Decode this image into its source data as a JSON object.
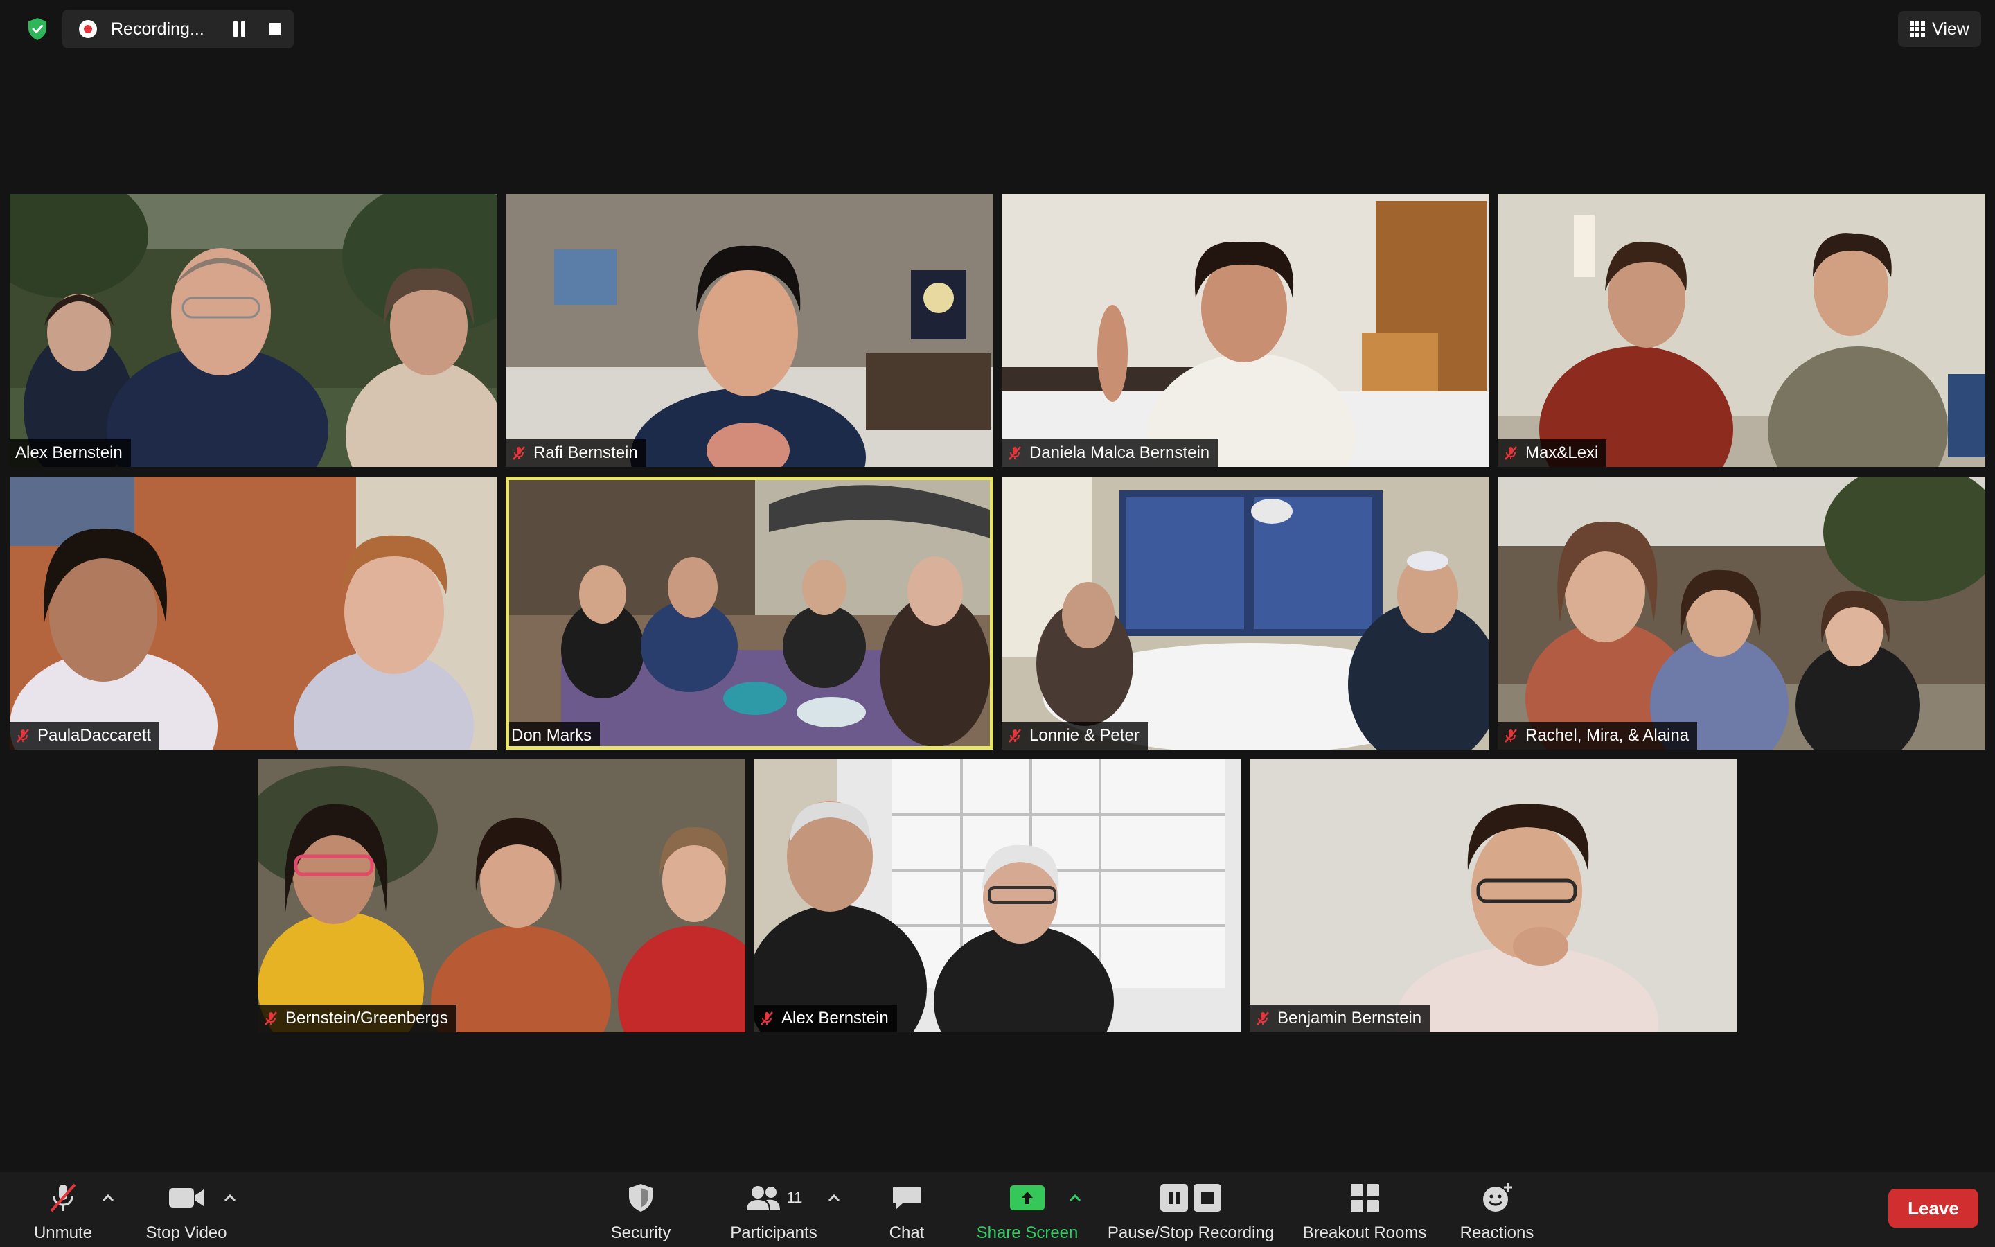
{
  "top_bar": {
    "recording_label": "Recording...",
    "view_label": "View",
    "icons": [
      "shield-check-icon",
      "record-icon",
      "pause-icon",
      "stop-icon",
      "grid-icon"
    ]
  },
  "tiles": [
    {
      "name": "Alex Bernstein",
      "muted": false,
      "active": false
    },
    {
      "name": "Rafi Bernstein",
      "muted": true,
      "active": false
    },
    {
      "name": "Daniela Malca Bernstein",
      "muted": true,
      "active": false
    },
    {
      "name": "Max&Lexi",
      "muted": true,
      "active": false
    },
    {
      "name": "PaulaDaccarett",
      "muted": true,
      "active": false
    },
    {
      "name": "Don Marks",
      "muted": false,
      "active": true
    },
    {
      "name": "Lonnie & Peter",
      "muted": true,
      "active": false
    },
    {
      "name": "Rachel, Mira, & Alaina",
      "muted": true,
      "active": false
    },
    {
      "name": "Bernstein/Greenbergs",
      "muted": true,
      "active": false
    },
    {
      "name": "Alex Bernstein",
      "muted": true,
      "active": false
    },
    {
      "name": "Benjamin Bernstein",
      "muted": true,
      "active": false
    }
  ],
  "toolbar": {
    "unmute_label": "Unmute",
    "stop_video_label": "Stop Video",
    "security_label": "Security",
    "participants_label": "Participants",
    "participants_count": "11",
    "chat_label": "Chat",
    "share_screen_label": "Share Screen",
    "pause_stop_recording_label": "Pause/Stop Recording",
    "breakout_rooms_label": "Breakout Rooms",
    "reactions_label": "Reactions",
    "leave_label": "Leave"
  },
  "colors": {
    "background": "#141414",
    "toolbar": "#1c1c1c",
    "active_speaker_border": "#e8e36a",
    "share_green": "#35c759",
    "leave_red": "#d12f2f",
    "mute_red": "#e0363c"
  }
}
